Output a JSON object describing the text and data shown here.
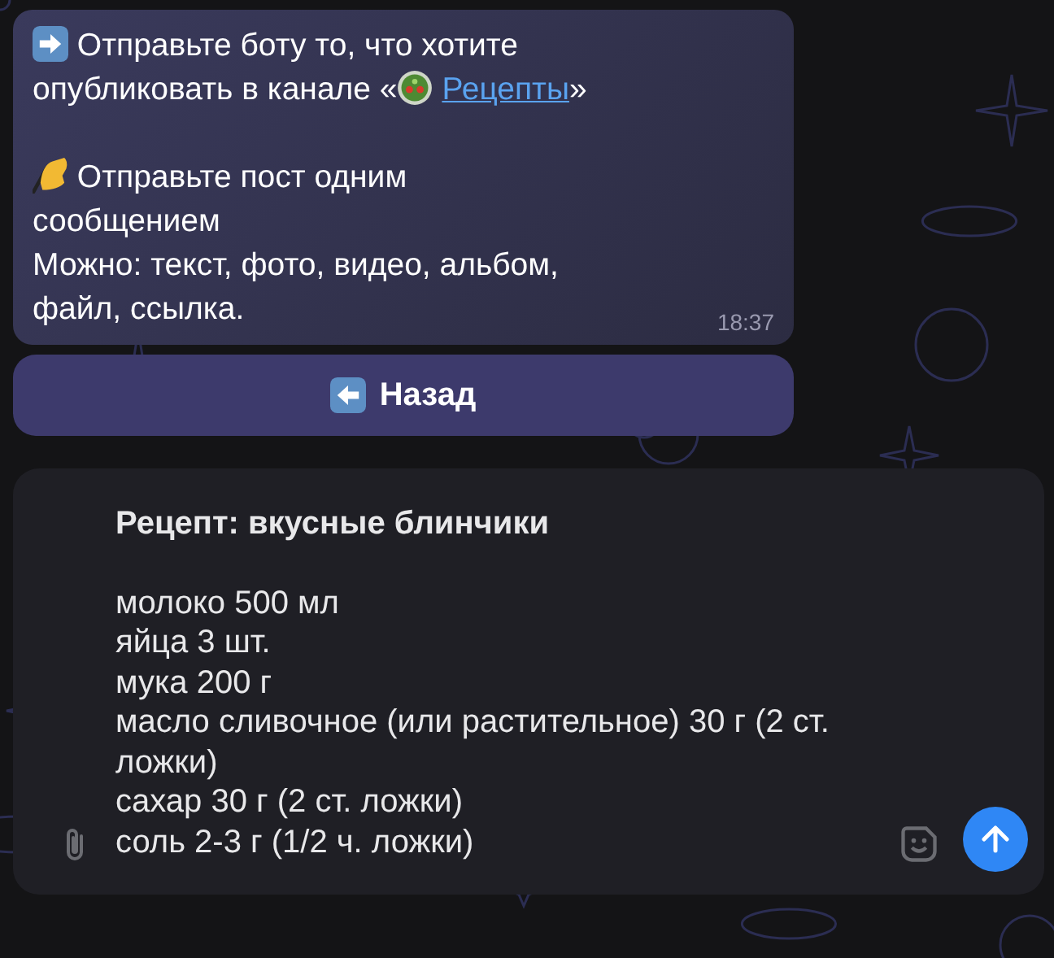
{
  "message": {
    "intro_text": "Отправьте боту то, что хотите опубликовать в канале «",
    "channel_link": "Рецепты",
    "intro_end": "»",
    "instruction": "Отправьте пост одним сообщением",
    "note": "Можно: текст, фото, видео, альбом, файл, ссылка.",
    "time": "18:37"
  },
  "back_button": {
    "label": "Назад"
  },
  "composer": {
    "title": "Рецепт: вкусные блинчики",
    "lines": [
      "молоко 500 мл",
      "яйца 3 шт.",
      "мука 200 г",
      "масло сливочное (или растительное) 30 г (2 ст. ложки)",
      "сахар 30 г (2 ст. ложки)",
      "соль 2-3 г (1/2 ч. ложки)"
    ]
  }
}
